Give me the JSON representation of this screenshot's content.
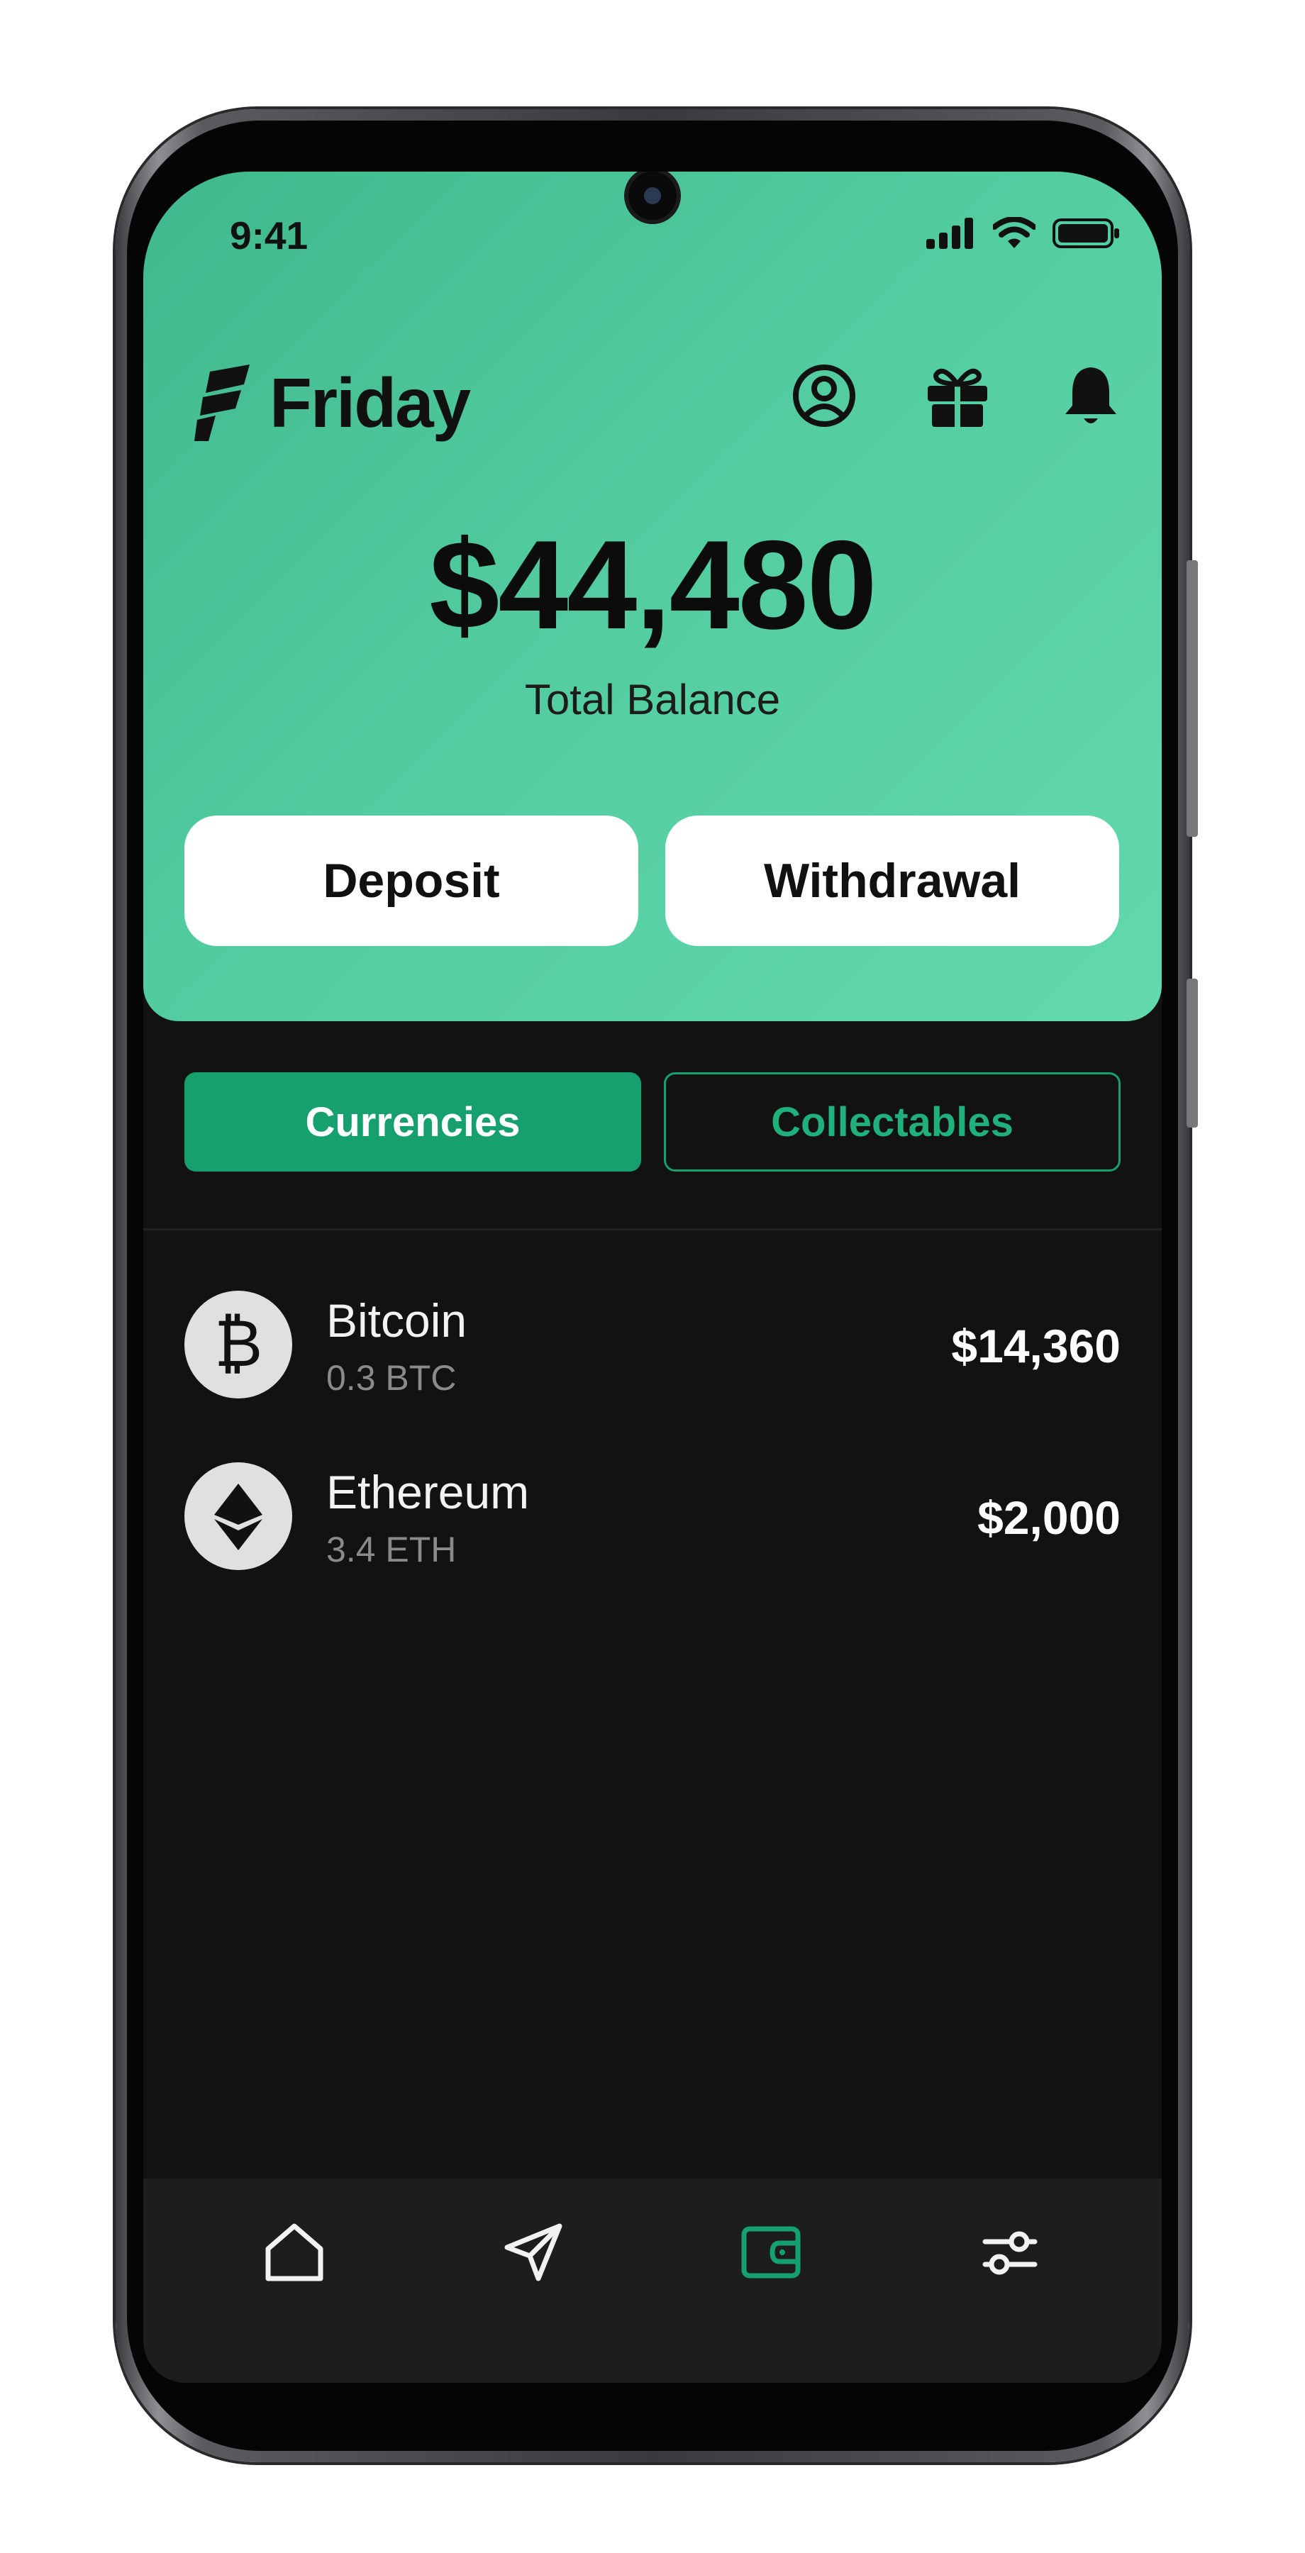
{
  "status_bar": {
    "time": "9:41",
    "icons": [
      "signal-icon",
      "wifi-icon",
      "battery-icon"
    ]
  },
  "header": {
    "brand_name": "Friday",
    "icons": [
      "profile-icon",
      "gift-icon",
      "bell-icon"
    ]
  },
  "balance": {
    "amount": "$44,480",
    "label": "Total Balance"
  },
  "actions": {
    "deposit_label": "Deposit",
    "withdrawal_label": "Withdrawal"
  },
  "tabs": [
    {
      "label": "Currencies",
      "active": true
    },
    {
      "label": "Collectables",
      "active": false
    }
  ],
  "assets": [
    {
      "name": "Bitcoin",
      "amount": "0.3 BTC",
      "value": "$14,360",
      "icon": "bitcoin-icon"
    },
    {
      "name": "Ethereum",
      "amount": "3.4 ETH",
      "value": "$2,000",
      "icon": "ethereum-icon"
    }
  ],
  "bottom_nav": [
    {
      "icon": "home-icon",
      "active": false
    },
    {
      "icon": "send-icon",
      "active": false
    },
    {
      "icon": "wallet-icon",
      "active": true
    },
    {
      "icon": "settings-sliders-icon",
      "active": false
    }
  ],
  "colors": {
    "header_green": "#52cc9f",
    "accent_green": "#15a06e",
    "background_dark": "#121212",
    "nav_background": "#1d1d1d"
  }
}
